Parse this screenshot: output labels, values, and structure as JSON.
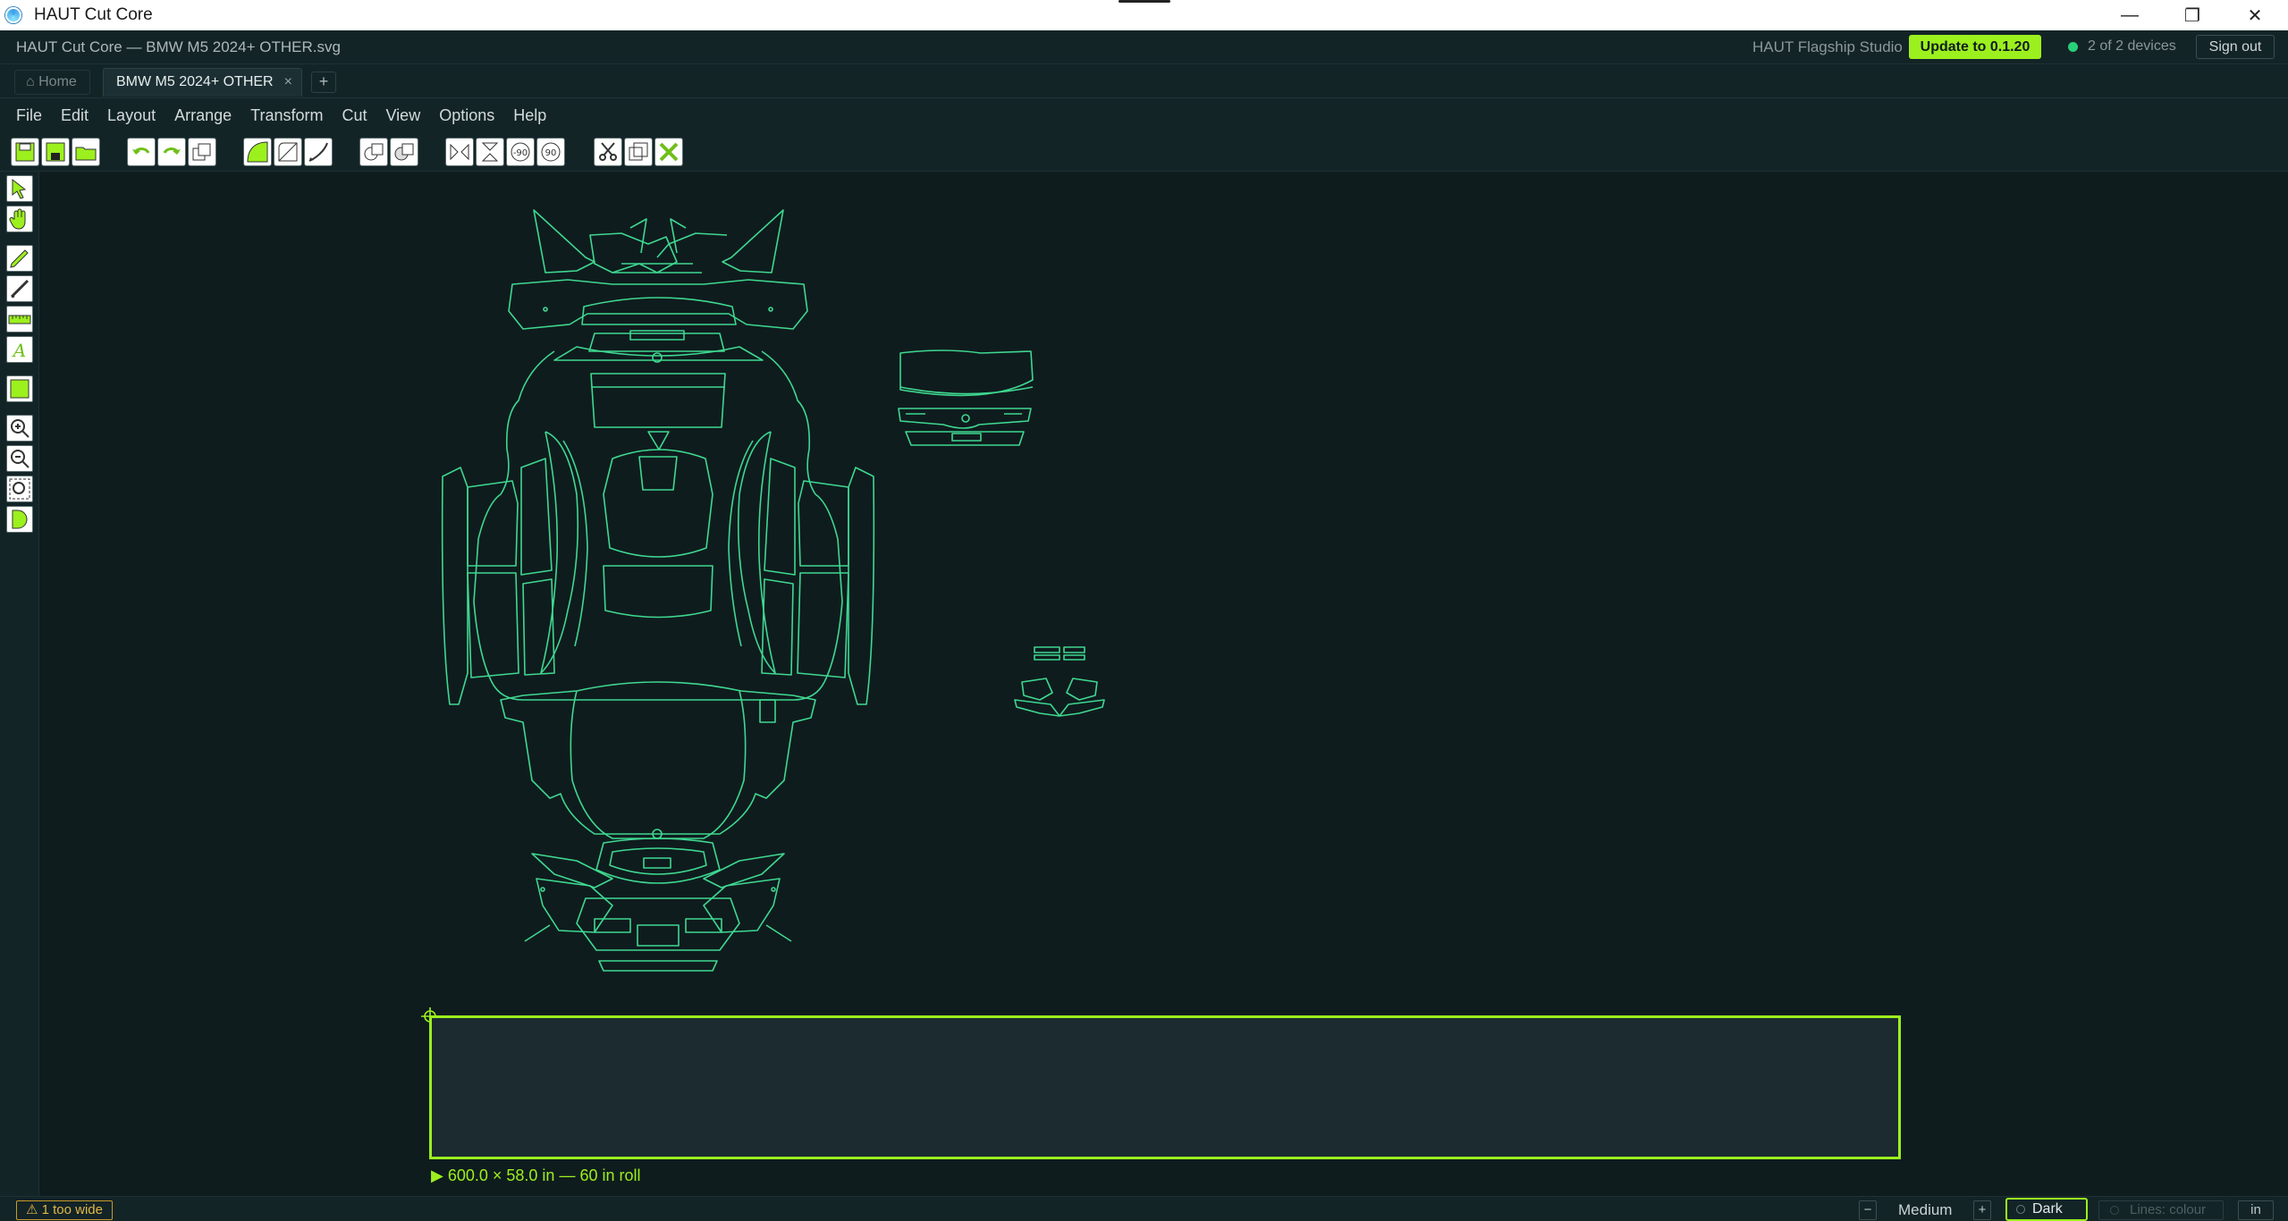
{
  "window": {
    "title": "HAUT Cut Core"
  },
  "header": {
    "document_title": "HAUT Cut Core — BMW M5 2024+ OTHER.svg",
    "studio": "HAUT Flagship Studio",
    "update_label": "Update to 0.1.20",
    "devices": "2 of 2 devices",
    "signout_label": "Sign out"
  },
  "tabs": {
    "home": "⌂ Home",
    "active": "BMW M5 2024+ OTHER",
    "close": "×",
    "add": "+"
  },
  "menu": [
    "File",
    "Edit",
    "Layout",
    "Arrange",
    "Transform",
    "Cut",
    "View",
    "Options",
    "Help"
  ],
  "toolbar": {
    "rotate_left": "-90",
    "rotate_right": "90"
  },
  "roll": {
    "label": "▶ 600.0 × 58.0 in — 60 in roll"
  },
  "status": {
    "warning": "⚠ 1 too wide",
    "zoom_minus": "−",
    "quality": "Medium",
    "zoom_plus": "+",
    "theme": "Dark",
    "lines": "Lines: colour",
    "units": "in"
  },
  "colors": {
    "accent": "#9cf01e",
    "outline": "#3fd890",
    "background": "#0f1c1e",
    "roll": "#1b2b30"
  }
}
